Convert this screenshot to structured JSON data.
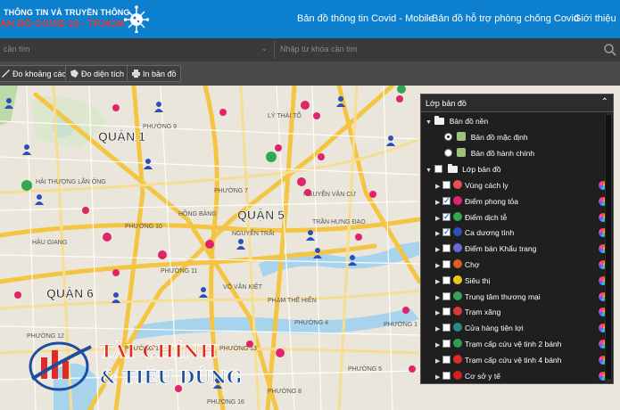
{
  "header": {
    "brand_line1": "THÔNG TIN VÀ TRUYỀN THÔNG",
    "brand_line2": "ẢN ĐỒ COVID 19 - TP.HCM",
    "nav": [
      {
        "label": "Bản đồ thông tin Covid - Mobile"
      },
      {
        "label": "Bản đồ hỗ trợ phòng chống Covid"
      },
      {
        "label": "Giới thiệu"
      }
    ]
  },
  "search": {
    "select_placeholder": "cần tìm",
    "keyword_placeholder": "Nhập từ khóa cần tìm"
  },
  "toolbar": {
    "measure_distance": "Đo khoảng cách",
    "measure_area": "Đo diện tích",
    "print_map": "In bản đồ"
  },
  "map": {
    "district_labels": [
      "QUẬN 1",
      "QUẬN 5",
      "QUẬN 6"
    ],
    "street_labels": [
      "PHƯỜNG 9",
      "PHƯỜNG 7",
      "PHƯỜNG 11",
      "PHƯỜNG 10",
      "PHƯỜNG 4",
      "PHƯỜNG 12",
      "PHƯỜNG 14",
      "PHƯỜNG 13",
      "PHƯỜNG 5",
      "PHƯỜNG 1",
      "PHƯỜNG 16",
      "PHƯỜNG 8",
      "LÝ THÁI TỔ",
      "NGUYỄN TRÃI",
      "HỒNG BÀNG",
      "HẢI THƯỢNG LÃN ÔNG",
      "VÕ VĂN KIỆT",
      "TRẦN HƯNG ĐẠO",
      "NGUYỄN VĂN CỪ",
      "PHẠM THẾ HIỂN",
      "HẬU GIANG"
    ]
  },
  "layer_panel": {
    "title": "Lớp bản đồ",
    "base_group": "Bản đồ nền",
    "base_layers": [
      {
        "label": "Bản đồ mặc định",
        "selected": true
      },
      {
        "label": "Bản đồ hành chính",
        "selected": false
      }
    ],
    "overlay_group": "Lớp bản đồ",
    "layers": [
      {
        "label": "Vùng cách ly",
        "checked": false,
        "color": "#e65050"
      },
      {
        "label": "Điểm phong tỏa",
        "checked": true,
        "color": "#e0246a"
      },
      {
        "label": "Điểm dịch tễ",
        "checked": true,
        "color": "#2fa84f"
      },
      {
        "label": "Ca dương tính",
        "checked": true,
        "color": "#2d4fb8"
      },
      {
        "label": "Điểm bán Khẩu trang",
        "checked": false,
        "color": "#6a6ad8"
      },
      {
        "label": "Chợ",
        "checked": false,
        "color": "#e05a2a"
      },
      {
        "label": "Siêu thị",
        "checked": false,
        "color": "#e8c81e"
      },
      {
        "label": "Trung tâm thương mại",
        "checked": false,
        "color": "#3aa05a"
      },
      {
        "label": "Trạm xăng",
        "checked": false,
        "color": "#d83a3a"
      },
      {
        "label": "Cửa hàng tiện lợi",
        "checked": false,
        "color": "#2a8a8a"
      },
      {
        "label": "Trạm cấp cứu vệ tinh 2 bánh",
        "checked": false,
        "color": "#2aa050"
      },
      {
        "label": "Trạm cấp cứu vệ tinh 4 bánh",
        "checked": false,
        "color": "#e02a2a"
      },
      {
        "label": "Cơ sở y tế",
        "checked": false,
        "color": "#d02020"
      }
    ]
  },
  "watermark": {
    "line1": "TÀI CHÍNH",
    "line2": "& TIÊU DÙNG"
  }
}
